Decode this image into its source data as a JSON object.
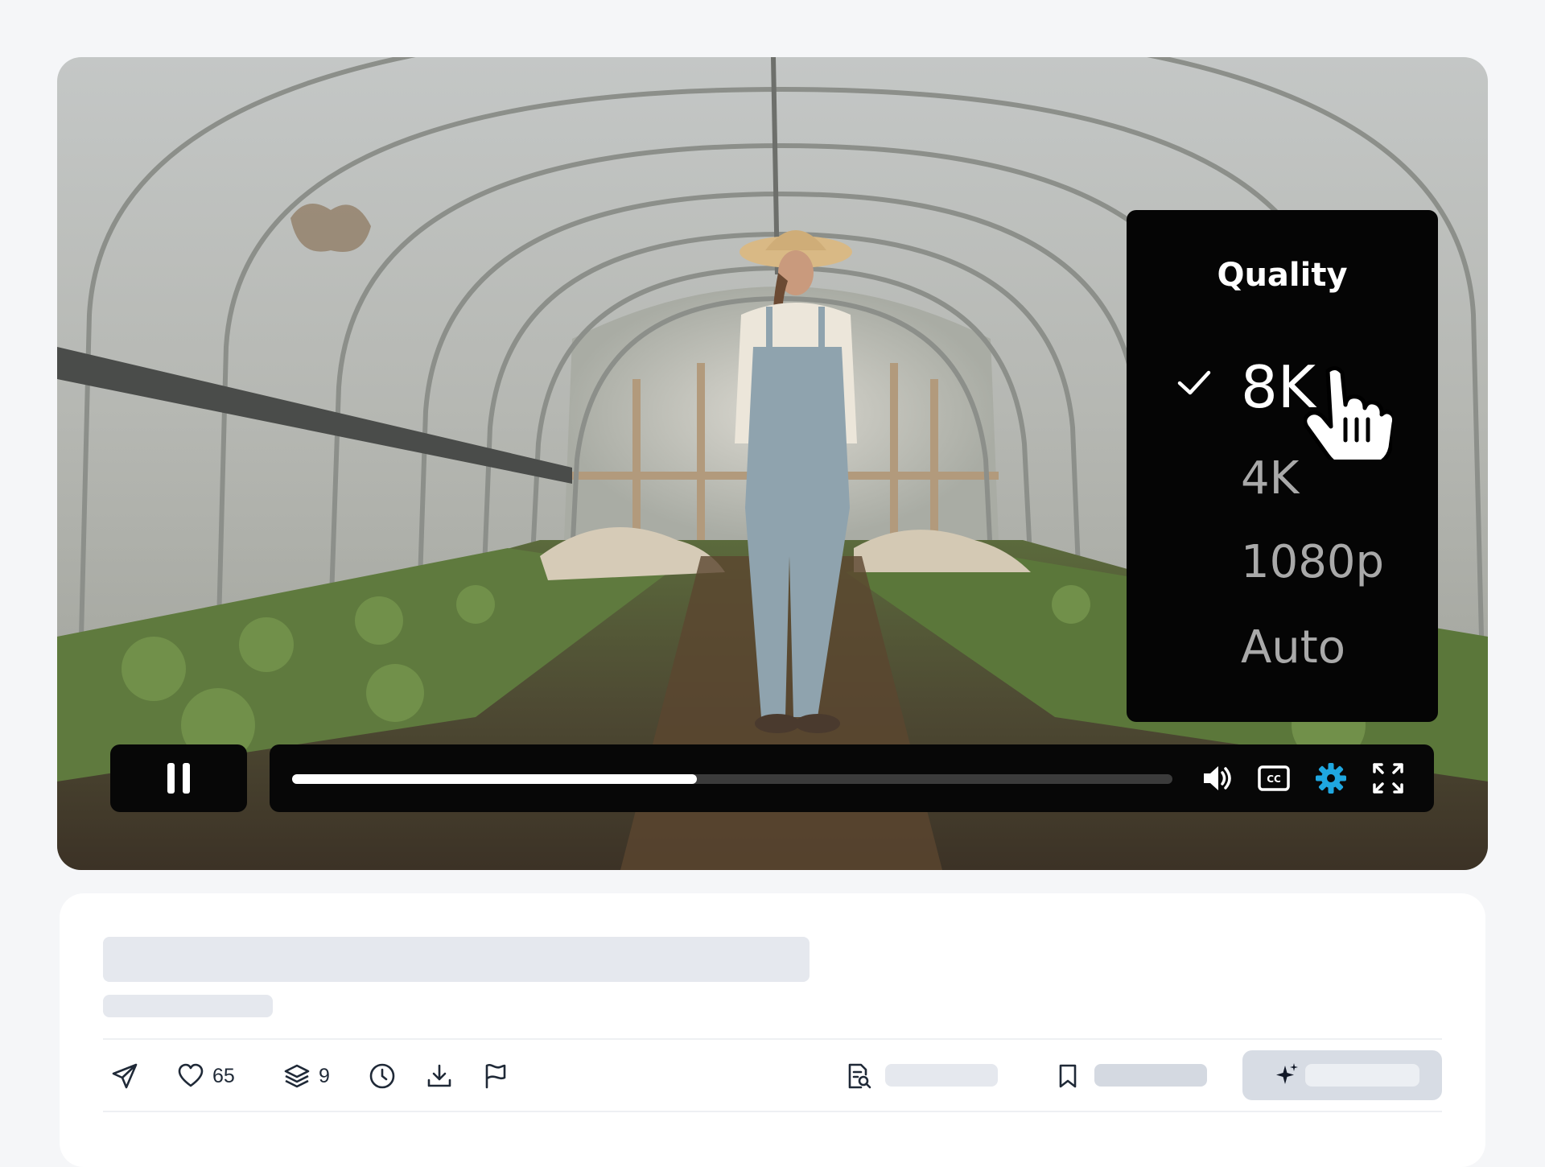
{
  "player": {
    "quality_menu": {
      "title": "Quality",
      "options": [
        "8K",
        "4K",
        "1080p",
        "Auto"
      ],
      "selected": "8K"
    },
    "progress": 0.46,
    "controls": [
      "pause-icon",
      "volume-icon",
      "closed-captions-icon",
      "settings-gear-icon",
      "fullscreen-icon"
    ],
    "cc_label": "CC",
    "accent_color": "#1fa7e0"
  },
  "actions": {
    "likes_count": "65",
    "collections_count": "9"
  },
  "icons": [
    "send-icon",
    "heart-icon",
    "layers-icon",
    "clock-icon",
    "download-icon",
    "flag-icon",
    "document-search-icon",
    "bookmark-icon",
    "sparkle-icon"
  ]
}
